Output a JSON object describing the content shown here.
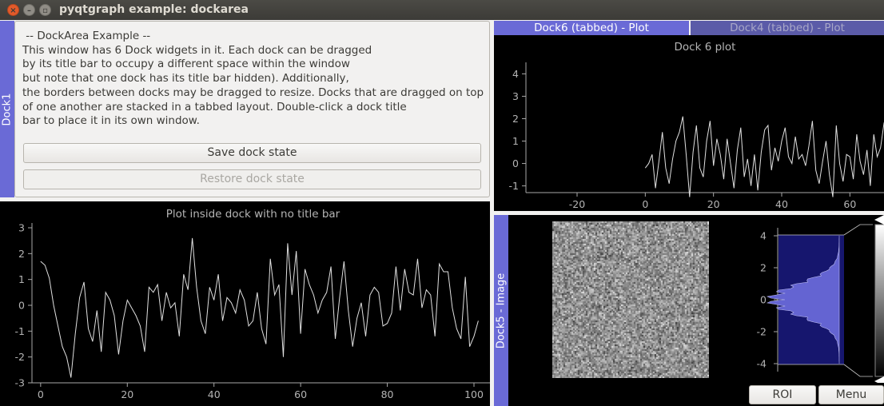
{
  "window": {
    "title": "pyqtgraph example: dockarea"
  },
  "dock1": {
    "label": "Dock1",
    "info_text": " -- DockArea Example -- \nThis window has 6 Dock widgets in it. Each dock can be dragged\nby its title bar to occupy a different space within the window\nbut note that one dock has its title bar hidden). Additionally,\nthe borders between docks may be dragged to resize. Docks that are dragged on top\nof one another are stacked in a tabbed layout. Double-click a dock title\nbar to place it in its own window.",
    "save_label": "Save dock state",
    "restore_label": "Restore dock state"
  },
  "tabs": [
    {
      "label": "Dock6 (tabbed) - Plot",
      "active": true
    },
    {
      "label": "Dock4 (tabbed) - Plot",
      "active": false
    }
  ],
  "dock5": {
    "label": "Dock5 - Image",
    "roi_label": "ROI",
    "menu_label": "Menu"
  },
  "chart_data": [
    {
      "type": "line",
      "title": "Plot inside dock with no title bar",
      "xlim": [
        -2,
        100
      ],
      "ylim": [
        -3,
        3
      ],
      "xticks": [
        0,
        20,
        40,
        60,
        80,
        100
      ],
      "yticks": [
        -3,
        -2,
        -1,
        0,
        1,
        2,
        3
      ],
      "series": [
        {
          "values": [
            1.7,
            1.55,
            1.05,
            0.0,
            -0.8,
            -1.6,
            -2.0,
            -2.8,
            -1.1,
            0.3,
            0.9,
            -0.9,
            -1.4,
            -0.2,
            -1.8,
            0.5,
            0.2,
            -0.4,
            -1.9,
            -0.6,
            0.2,
            -0.1,
            -0.4,
            -0.8,
            -1.8,
            0.7,
            0.5,
            0.8,
            -0.6,
            0.5,
            -0.1,
            0.1,
            -1.2,
            1.2,
            0.6,
            2.6,
            0.7,
            -0.6,
            -1.1,
            0.7,
            0.2,
            1.2,
            -0.6,
            0.3,
            0.1,
            -0.3,
            0.6,
            0.2,
            -0.8,
            -0.6,
            0.5,
            -0.9,
            -1.5,
            1.8,
            0.4,
            0.8,
            -2.0,
            2.4,
            0.4,
            2.1,
            -1.1,
            1.4,
            0.8,
            0.4,
            -0.3,
            0.2,
            0.5,
            1.5,
            -1.3,
            0.3,
            1.7,
            -0.2,
            -1.6,
            -0.5,
            0.1,
            -1.2,
            0.4,
            0.7,
            0.5,
            -0.8,
            -0.7,
            -0.3,
            1.5,
            -0.2,
            1.4,
            0.5,
            0.4,
            1.8,
            -0.1,
            0.6,
            0.4,
            -1.2,
            1.6,
            1.3,
            1.3,
            -0.1,
            -0.9,
            -1.3,
            1.1,
            -1.6,
            -1.2,
            -0.6
          ]
        }
      ]
    },
    {
      "type": "line",
      "title": "Dock 6 plot",
      "xlim": [
        -35,
        70
      ],
      "ylim": [
        -1.3,
        4.3
      ],
      "xticks": [
        -20,
        0,
        20,
        40,
        60
      ],
      "yticks": [
        -1,
        0,
        1,
        2,
        3,
        4
      ],
      "series": [
        {
          "x_start": 0,
          "values": [
            -0.2,
            0.0,
            0.4,
            -1.1,
            0.1,
            1.4,
            -0.2,
            -0.9,
            0.2,
            1.0,
            1.4,
            2.1,
            0.4,
            -1.5,
            0.5,
            1.7,
            -0.2,
            -0.6,
            1.0,
            1.9,
            -0.1,
            1.1,
            0.4,
            -0.7,
            1.1,
            0.0,
            -1.1,
            0.6,
            1.6,
            -0.6,
            0.2,
            -1.0,
            0.4,
            -1.2,
            0.5,
            1.5,
            1.7,
            -0.3,
            0.7,
            0.1,
            1.0,
            1.6,
            0.3,
            0.0,
            1.2,
            0.2,
            0.4,
            -0.1,
            0.8,
            1.9,
            -0.3,
            -0.9,
            0.1,
            1.0,
            -0.5,
            -1.5,
            1.7,
            0.0,
            -0.8,
            0.4,
            0.3,
            -0.7,
            1.3,
            0.1,
            -0.5,
            0.6,
            -1.0,
            1.3,
            0.3,
            0.7,
            1.8,
            2.3,
            1.2,
            -0.1,
            0.8,
            1.1,
            0.9
          ]
        }
      ]
    },
    {
      "type": "area",
      "ylim": [
        -4.3,
        4.3
      ],
      "yticks": [
        -4,
        -2,
        0,
        2,
        4
      ]
    }
  ]
}
